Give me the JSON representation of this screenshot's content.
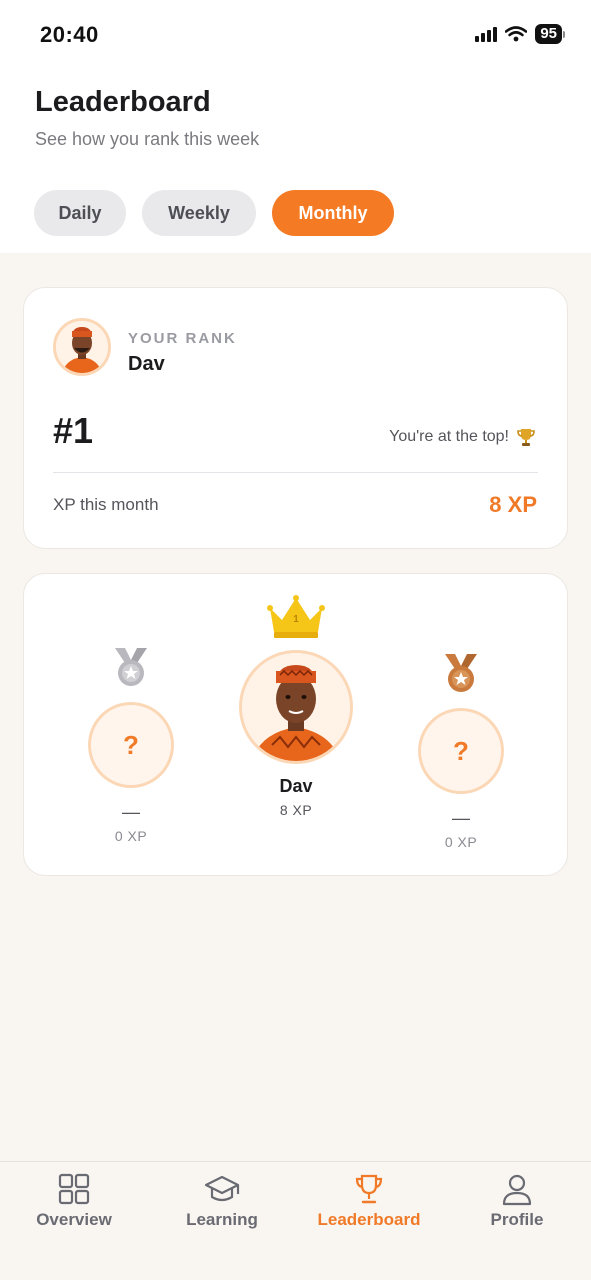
{
  "status_bar": {
    "time": "20:40",
    "battery": "95"
  },
  "header": {
    "title": "Leaderboard",
    "subtitle": "See how you rank this week"
  },
  "period_tabs": [
    {
      "label": "Daily",
      "active": false
    },
    {
      "label": "Weekly",
      "active": false
    },
    {
      "label": "Monthly",
      "active": true
    }
  ],
  "rank_card": {
    "label": "YOUR RANK",
    "name": "Dav",
    "rank": "#1",
    "message": "You're at the top!",
    "xp_label": "XP this month",
    "xp_value": "8 XP"
  },
  "podium": [
    {
      "place": 2,
      "medal": "silver-medal-icon",
      "name": "—",
      "xp": "0 XP",
      "avatar": "?"
    },
    {
      "place": 1,
      "medal": "crown-icon",
      "name": "Dav",
      "xp": "8 XP"
    },
    {
      "place": 3,
      "medal": "bronze-medal-icon",
      "name": "—",
      "xp": "0 XP",
      "avatar": "?"
    }
  ],
  "bottom_nav": [
    {
      "label": "Overview",
      "icon": "grid-icon",
      "active": false
    },
    {
      "label": "Learning",
      "icon": "graduation-cap-icon",
      "active": false
    },
    {
      "label": "Leaderboard",
      "icon": "trophy-icon",
      "active": true
    },
    {
      "label": "Profile",
      "icon": "user-icon",
      "active": false
    }
  ],
  "colors": {
    "accent": "#f47a24",
    "gold": "#f5c518",
    "silver": "#b8b8be",
    "bronze": "#c97a3c"
  }
}
